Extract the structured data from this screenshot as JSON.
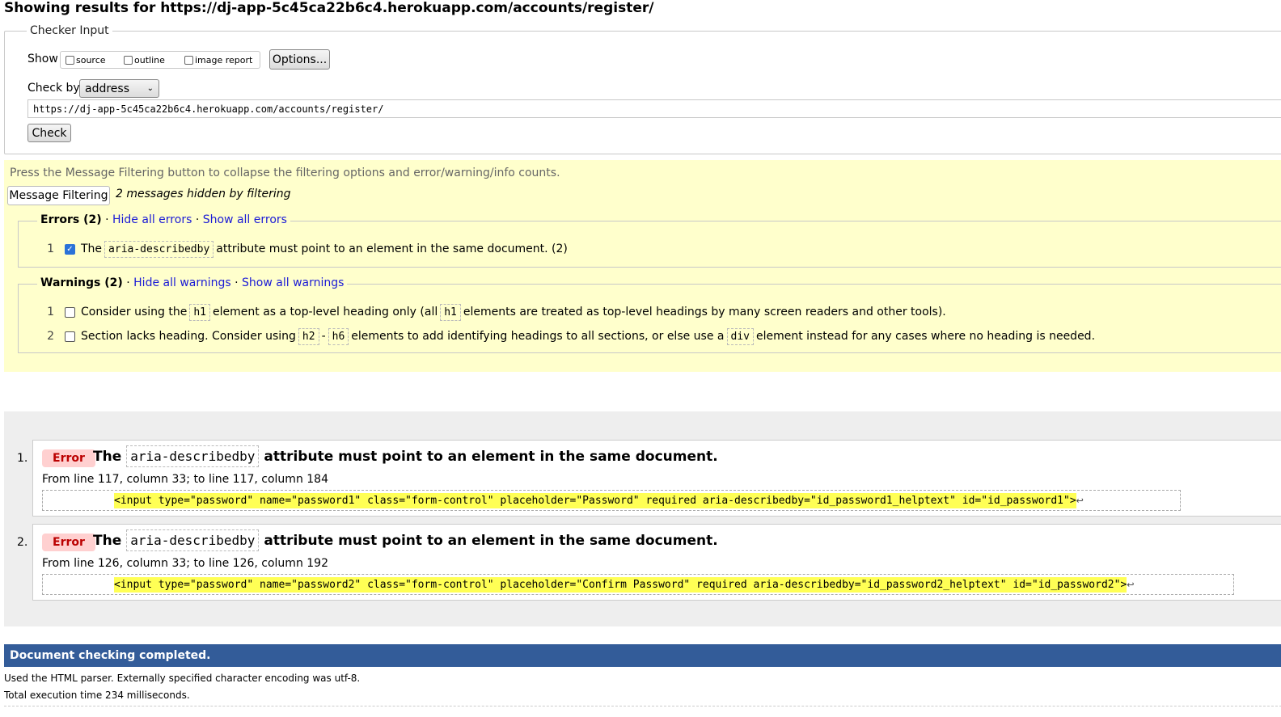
{
  "page_title": "Showing results for https://dj-app-5c45ca22b6c4.herokuapp.com/accounts/register/",
  "checker": {
    "legend": "Checker Input",
    "show_label": "Show",
    "show_options": [
      "source",
      "outline",
      "image report"
    ],
    "options_button": "Options...",
    "check_by_label": "Check by",
    "check_by_value": "address",
    "url_value": "https://dj-app-5c45ca22b6c4.herokuapp.com/accounts/register/",
    "check_button": "Check"
  },
  "filtering": {
    "hint": "Press the Message Filtering button to collapse the filtering options and error/warning/info counts.",
    "button": "Message Filtering",
    "hidden_note": "2 messages hidden by filtering",
    "errors": {
      "title": "Errors (2)",
      "sep": "·",
      "hide_link": "Hide all errors",
      "show_link": "Show all errors",
      "items": [
        {
          "num": "1",
          "checked": true,
          "pre": "The",
          "code": "aria-describedby",
          "post": "attribute must point to an element in the same document. (2)"
        }
      ]
    },
    "warnings": {
      "title": "Warnings (2)",
      "sep": "·",
      "hide_link": "Hide all warnings",
      "show_link": "Show all warnings",
      "items": [
        {
          "num": "1",
          "t1": "Consider using the",
          "c1": "h1",
          "t2": "element as a top-level heading only (all",
          "c2": "h1",
          "t3": "elements are treated as top-level headings by many screen readers and other tools)."
        },
        {
          "num": "2",
          "t1": "Section lacks heading. Consider using",
          "c1": "h2",
          "dash": "-",
          "c2": "h6",
          "t2": "elements to add identifying headings to all sections, or else use a",
          "c3": "div",
          "t3": "element instead for any cases where no heading is needed."
        }
      ]
    }
  },
  "results": [
    {
      "num": "1.",
      "badge": "Error",
      "t_pre": "The",
      "code": "aria-describedby",
      "t_post": "attribute must point to an element in the same document.",
      "location": "From line 117, column 33; to line 117, column 184",
      "extract": "<input type=\"password\" name=\"password1\" class=\"form-control\" placeholder=\"Password\" required aria-describedby=\"id_password1_helptext\" id=\"id_password1\">",
      "ret": "↩"
    },
    {
      "num": "2.",
      "badge": "Error",
      "t_pre": "The",
      "code": "aria-describedby",
      "t_post": "attribute must point to an element in the same document.",
      "location": "From line 126, column 33; to line 126, column 192",
      "extract": "<input type=\"password\" name=\"password2\" class=\"form-control\" placeholder=\"Confirm Password\" required aria-describedby=\"id_password2_helptext\" id=\"id_password2\">",
      "ret": "↩"
    }
  ],
  "footer": {
    "completed": "Document checking completed.",
    "parser_note": "Used the HTML parser. Externally specified character encoding was utf-8.",
    "time_note": "Total execution time 234 milliseconds."
  },
  "colors": {
    "error_badge_bg": "#ffd0d0",
    "filter_bg": "#ffffcc",
    "done_bar": "#335c99",
    "extract_highlight": "#ffff55"
  }
}
